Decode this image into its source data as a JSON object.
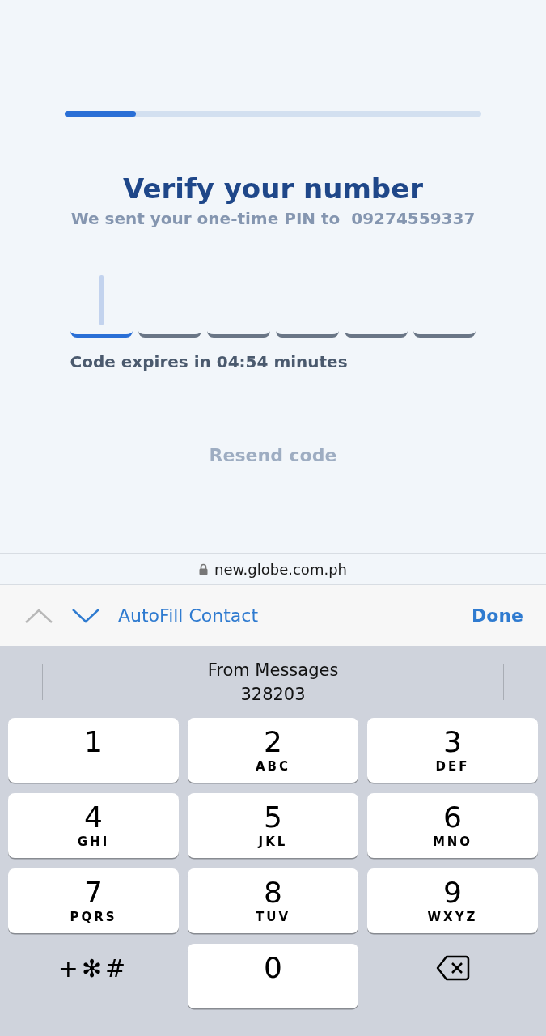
{
  "progress": {
    "level": 0.17
  },
  "title": "Verify your number",
  "subtitle": "We sent your one-time PIN to  09274559337",
  "pin_boxes": [
    {
      "selected": true
    },
    {
      "selected": false
    },
    {
      "selected": false
    },
    {
      "selected": false
    },
    {
      "selected": false
    },
    {
      "selected": false
    }
  ],
  "expiry": "Code expires in 04:54 minutes",
  "resend": {
    "label": "Resend code",
    "disabled": true
  },
  "url_bar": {
    "address": "new.globe.com.ph"
  },
  "accessory_bar": {
    "prev_disabled": true,
    "next_disabled": false,
    "autofill": "AutoFill Contact",
    "done": "Done"
  },
  "suggestion": {
    "source": "From Messages",
    "code": "328203"
  },
  "keys": [
    {
      "kind": "digit",
      "digit": "1"
    },
    {
      "kind": "digit",
      "digit": "2",
      "letters": "ABC"
    },
    {
      "kind": "digit",
      "digit": "3",
      "letters": "DEF"
    },
    {
      "kind": "digit",
      "digit": "4",
      "letters": "GHI"
    },
    {
      "kind": "digit",
      "digit": "5",
      "letters": "JKL"
    },
    {
      "kind": "digit",
      "digit": "6",
      "letters": "MNO"
    },
    {
      "kind": "digit",
      "digit": "7",
      "letters": "PQRS"
    },
    {
      "kind": "digit",
      "digit": "8",
      "letters": "TUV"
    },
    {
      "kind": "digit",
      "digit": "9",
      "letters": "WXYZ"
    },
    {
      "kind": "symbols",
      "label": "+✻#"
    },
    {
      "kind": "digit",
      "digit": "0"
    },
    {
      "kind": "delete"
    }
  ]
}
